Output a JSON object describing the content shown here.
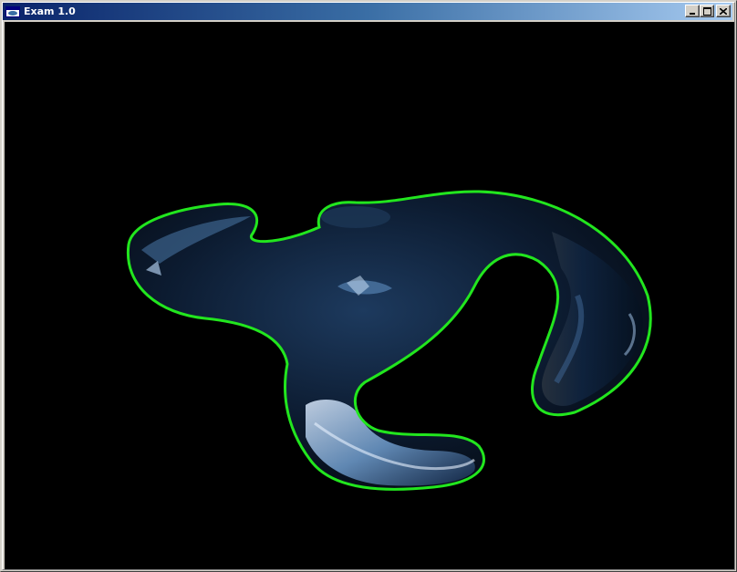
{
  "window": {
    "title": "Exam 1.0",
    "buttons": {
      "minimize": "minimize",
      "maximize": "maximize",
      "close": "close"
    }
  },
  "scene": {
    "background": "#000000",
    "outline_color": "#22e61e",
    "object_color": "#0d1e33",
    "highlight_color": "#b8d2ee"
  },
  "icons": {
    "app": "app-window-icon",
    "minimize": "minimize-icon",
    "maximize": "maximize-icon",
    "close": "close-icon"
  }
}
